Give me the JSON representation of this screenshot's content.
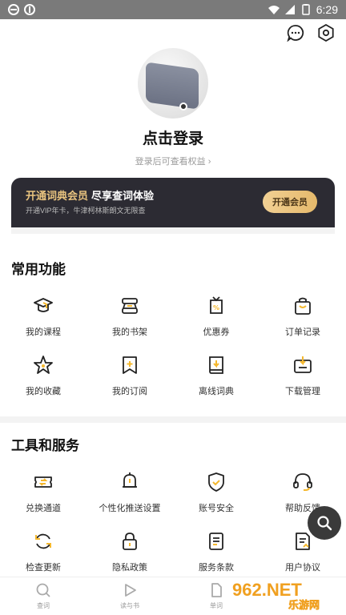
{
  "status_bar": {
    "time": "6:29"
  },
  "profile": {
    "title": "点击登录",
    "subtitle": "登录后可查看权益 ›"
  },
  "vip": {
    "title_gold": "开通词典会员",
    "title_white": "尽享查词体验",
    "desc": "开通VIP年卡，牛津柯林斯朗文无限查",
    "button": "开通会员"
  },
  "common": {
    "title": "常用功能",
    "items": [
      {
        "label": "我的课程",
        "icon": "graduation-cap-icon"
      },
      {
        "label": "我的书架",
        "icon": "bookshelf-icon"
      },
      {
        "label": "优惠券",
        "icon": "coupon-icon"
      },
      {
        "label": "订单记录",
        "icon": "shopping-bag-icon"
      },
      {
        "label": "我的收藏",
        "icon": "star-icon"
      },
      {
        "label": "我的订阅",
        "icon": "subscribe-icon"
      },
      {
        "label": "离线词典",
        "icon": "offline-dictionary-icon"
      },
      {
        "label": "下载管理",
        "icon": "download-icon"
      }
    ]
  },
  "tools": {
    "title": "工具和服务",
    "items": [
      {
        "label": "兑换通道",
        "icon": "exchange-ticket-icon"
      },
      {
        "label": "个性化推送设置",
        "icon": "bell-icon"
      },
      {
        "label": "账号安全",
        "icon": "shield-icon"
      },
      {
        "label": "帮助反馈",
        "icon": "headset-icon"
      },
      {
        "label": "检查更新",
        "icon": "refresh-icon"
      },
      {
        "label": "隐私政策",
        "icon": "lock-icon"
      },
      {
        "label": "服务条款",
        "icon": "document-icon"
      },
      {
        "label": "用户协议",
        "icon": "agreement-icon"
      }
    ]
  },
  "tabbar": [
    {
      "label": "查词",
      "icon": "search-icon"
    },
    {
      "label": "读与书",
      "icon": "play-icon"
    },
    {
      "label": "单词",
      "icon": "page-icon"
    }
  ],
  "watermark": {
    "text1": "962.NET",
    "text2": "乐游网"
  },
  "colors": {
    "accent": "#f5b82e",
    "vip_bg": "#2c2b33",
    "vip_gold": "#e9c47f"
  }
}
